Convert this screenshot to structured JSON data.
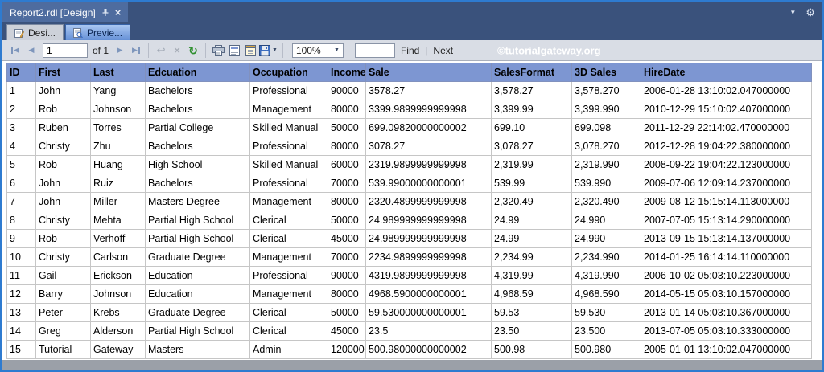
{
  "window": {
    "document_tab": "Report2.rdl [Design]",
    "design_tab": "Desi...",
    "preview_tab": "Previe..."
  },
  "toolbar": {
    "current_page": "1",
    "pages_label": "of 1",
    "zoom_value": "100%",
    "find_label": "Find",
    "next_label": "Next",
    "watermark": "©tutorialgateway.org"
  },
  "glyphs": {
    "first_page": "◀",
    "prev_page": "◀",
    "next_page": "▶",
    "last_page": "▶",
    "back": "↩",
    "stop": "×",
    "refresh": "↻",
    "caret_down": "▼",
    "chevron_down": "▼",
    "gear": "⚙",
    "close": "×",
    "divider": "|"
  },
  "table": {
    "headers": [
      "ID",
      "First",
      "Last",
      "Edcuation",
      "Occupation",
      "Income",
      "Sale",
      "SalesFormat",
      "3D Sales",
      "HireDate"
    ],
    "rows": [
      [
        "1",
        "John",
        "Yang",
        "Bachelors",
        "Professional",
        "90000",
        "3578.27",
        "3,578.27",
        "3,578.270",
        "2006-01-28 13:10:02.047000000"
      ],
      [
        "2",
        "Rob",
        "Johnson",
        "Bachelors",
        "Management",
        "80000",
        "3399.9899999999998",
        "3,399.99",
        "3,399.990",
        "2010-12-29 15:10:02.407000000"
      ],
      [
        "3",
        "Ruben",
        "Torres",
        "Partial College",
        "Skilled Manual",
        "50000",
        "699.09820000000002",
        "699.10",
        "699.098",
        "2011-12-29 22:14:02.470000000"
      ],
      [
        "4",
        "Christy",
        "Zhu",
        "Bachelors",
        "Professional",
        "80000",
        "3078.27",
        "3,078.27",
        "3,078.270",
        "2012-12-28 19:04:22.380000000"
      ],
      [
        "5",
        "Rob",
        "Huang",
        "High School",
        "Skilled Manual",
        "60000",
        "2319.9899999999998",
        "2,319.99",
        "2,319.990",
        "2008-09-22 19:04:22.123000000"
      ],
      [
        "6",
        "John",
        "Ruiz",
        "Bachelors",
        "Professional",
        "70000",
        "539.99000000000001",
        "539.99",
        "539.990",
        "2009-07-06 12:09:14.237000000"
      ],
      [
        "7",
        "John",
        "Miller",
        "Masters Degree",
        "Management",
        "80000",
        "2320.4899999999998",
        "2,320.49",
        "2,320.490",
        "2009-08-12 15:15:14.113000000"
      ],
      [
        "8",
        "Christy",
        "Mehta",
        "Partial High School",
        "Clerical",
        "50000",
        "24.989999999999998",
        "24.99",
        "24.990",
        "2007-07-05 15:13:14.290000000"
      ],
      [
        "9",
        "Rob",
        "Verhoff",
        "Partial High School",
        "Clerical",
        "45000",
        "24.989999999999998",
        "24.99",
        "24.990",
        "2013-09-15 15:13:14.137000000"
      ],
      [
        "10",
        "Christy",
        "Carlson",
        "Graduate Degree",
        "Management",
        "70000",
        "2234.9899999999998",
        "2,234.99",
        "2,234.990",
        "2014-01-25 16:14:14.110000000"
      ],
      [
        "11",
        "Gail",
        "Erickson",
        "Education",
        "Professional",
        "90000",
        "4319.9899999999998",
        "4,319.99",
        "4,319.990",
        "2006-10-02 05:03:10.223000000"
      ],
      [
        "12",
        "Barry",
        "Johnson",
        "Education",
        "Management",
        "80000",
        "4968.5900000000001",
        "4,968.59",
        "4,968.590",
        "2014-05-15 05:03:10.157000000"
      ],
      [
        "13",
        "Peter",
        "Krebs",
        "Graduate Degree",
        "Clerical",
        "50000",
        "59.530000000000001",
        "59.53",
        "59.530",
        "2013-01-14 05:03:10.367000000"
      ],
      [
        "14",
        "Greg",
        "Alderson",
        "Partial High School",
        "Clerical",
        "45000",
        "23.5",
        "23.50",
        "23.500",
        "2013-07-05 05:03:10.333000000"
      ],
      [
        "15",
        "Tutorial",
        "Gateway",
        "Masters",
        "Admin",
        "120000",
        "500.98000000000002",
        "500.98",
        "500.980",
        "2005-01-01 13:10:02.047000000"
      ]
    ]
  }
}
